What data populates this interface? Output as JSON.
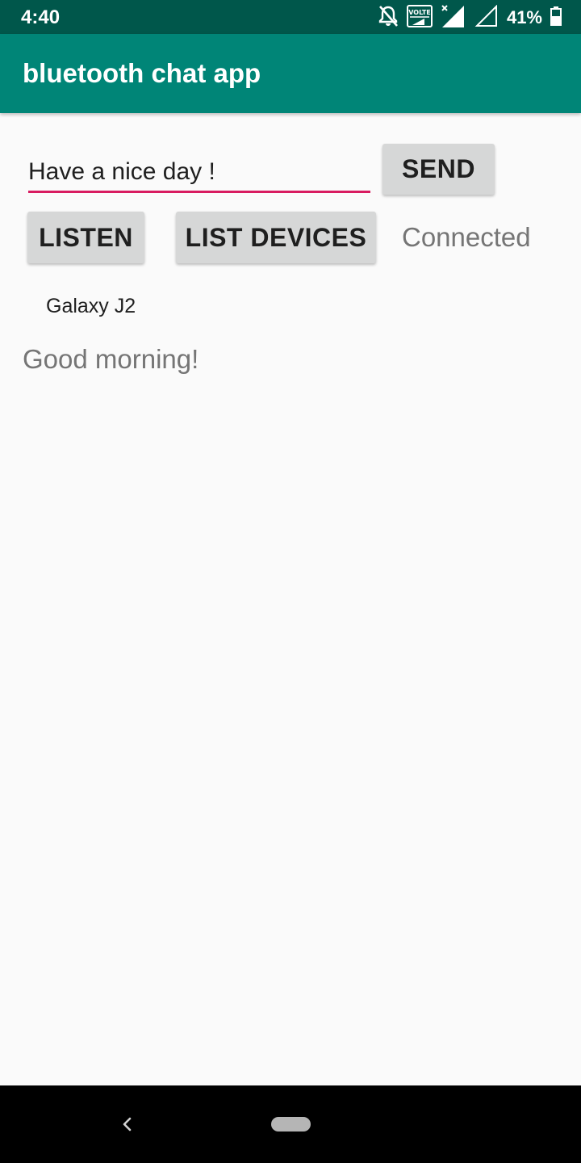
{
  "status_bar": {
    "time": "4:40",
    "battery_percent": "41%",
    "volte_label": "VOLTE",
    "icons": [
      "mute-notification-icon",
      "volte-icon",
      "signal-icon",
      "signal-icon",
      "battery-icon"
    ]
  },
  "app_bar": {
    "title": "bluetooth chat app"
  },
  "message_input": {
    "value": "Have a nice day !"
  },
  "buttons": {
    "send": "SEND",
    "listen": "LISTEN",
    "list_devices": "LIST DEVICES"
  },
  "connection_status": "Connected",
  "devices": [
    "Galaxy J2"
  ],
  "received_message": "Good morning!",
  "colors": {
    "status_bar": "#00574b",
    "app_bar": "#008577",
    "accent": "#d81b60",
    "button": "#d6d7d7",
    "background": "#fafafa"
  }
}
